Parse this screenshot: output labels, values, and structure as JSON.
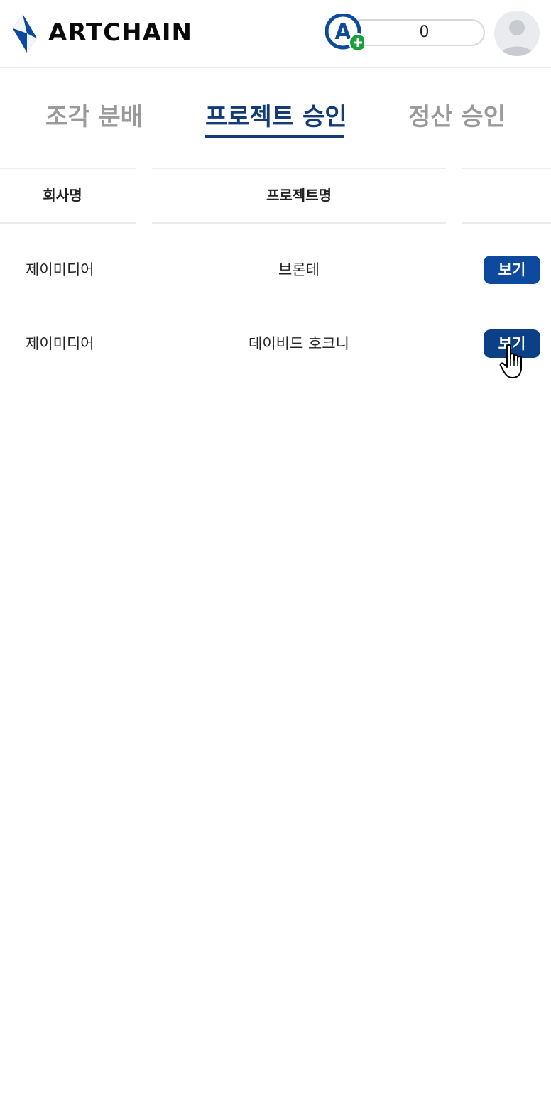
{
  "brand": {
    "name": "ARTCHAIN",
    "logo_icon": "artchain-diamond-logo",
    "primary_color": "#0d4a9e",
    "active_tab_color": "#123b78"
  },
  "header": {
    "token_balance": "0",
    "token_icon": "a-coin-add-icon",
    "avatar_icon": "user-avatar-icon"
  },
  "tabs": [
    {
      "label": "조각 분배",
      "active": false
    },
    {
      "label": "프로젝트 승인",
      "active": true
    },
    {
      "label": "정산 승인",
      "active": false
    }
  ],
  "table": {
    "columns": [
      "회사명",
      "프로젝트명",
      ""
    ],
    "rows": [
      {
        "company": "제이미디어",
        "project": "브론테",
        "action": "보기"
      },
      {
        "company": "제이미디어",
        "project": "데이비드 호크니",
        "action": "보기"
      }
    ]
  }
}
